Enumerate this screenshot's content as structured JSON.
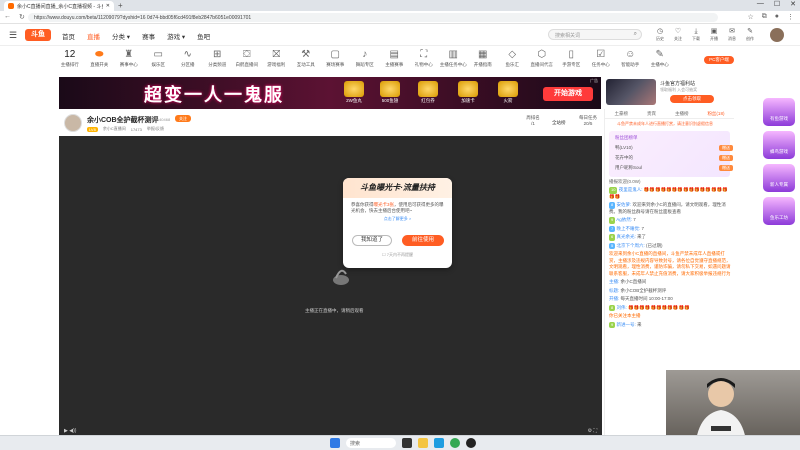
{
  "browser": {
    "tab_title": "余小C直播间直播_余小C直播视频 - 斗鱼",
    "url": "https://www.douyu.com/beta/11209079?dyshid=16 0d74-bbd05f6cd491f8eb2847b6051e00091701",
    "new_tab": "+",
    "win_min": "—",
    "win_max": "☐",
    "win_close": "✕"
  },
  "header": {
    "logo_text": "斗鱼",
    "nav": [
      "首页",
      "直播",
      "分类",
      "赛事",
      "游戏",
      "鱼吧"
    ],
    "search_placeholder": "搜索相关词",
    "icons": [
      "历史",
      "关注",
      "下载",
      "开播",
      "消息",
      "创作"
    ],
    "nav_badge": "9"
  },
  "categories": {
    "count_label": "主播排行",
    "count_value": "12",
    "items": [
      "直播开关",
      "赛事中心",
      "娱乐区",
      "分区播",
      "分类频道",
      "白鹤直播间",
      "游戏福利",
      "互动工具",
      "赛场赛事",
      "舞蹈专区",
      "主播赛事",
      "礼物中心",
      "主播任务中心",
      "开播指南",
      "鱼乐汇",
      "直播间代言",
      "手游专区",
      "任务中心",
      "智能助手",
      "主播中心"
    ]
  },
  "banner": {
    "title": "超变一人一鬼服",
    "prizes": [
      "2W鱼丸",
      "500鱼翅",
      "红包券",
      "加速卡",
      "火箭"
    ],
    "start_label": "开始游戏",
    "ad_label": "广告"
  },
  "promo": {
    "pc_tag": "PC客户端",
    "title": "斗鱼官方福利站",
    "subtitle": "领取福利 入会可抽奖",
    "button": "点击领取"
  },
  "room": {
    "title": "余小COB全护截杯测评",
    "room_id": "11140468",
    "follow": "关注",
    "badge": "LV8",
    "category": "余小C直播间",
    "heat": "17473",
    "report": "举报/反馈",
    "rank_label": "周排名",
    "rank_value": "/1",
    "all_station": "全站榜",
    "task_label": "每日任务",
    "task_value": "20/5"
  },
  "player": {
    "loading_text": "主播正在直播中，请稍后观看",
    "modal_title": "斗鱼曝光卡·流量扶持",
    "modal_body_1": "恭喜你获得",
    "modal_highlight": "曝光卡3张",
    "modal_body_2": "，使用后可获得更多的曝光机会，快去主播后台使用吧~",
    "modal_link": "点击了解更多 >",
    "btn_know": "我知道了",
    "btn_sign": "前往使用",
    "modal_foot": "7天内不再提醒",
    "ctrl_left": "▶  ◀))",
    "ctrl_right": "⚙  ⛶"
  },
  "sidebar": {
    "tabs": [
      "土豪榜",
      "贵宾",
      "主播榜",
      "粉丝(18)"
    ],
    "notice": "斗鱼严禁未成年人进行直播打赏，请注意识别虚假信息",
    "fan_title": "粉丝团榜单",
    "fan_rows": [
      {
        "name": "鸭(LV10)",
        "tag": "赠送"
      },
      {
        "name": "花卉中的",
        "tag": "赠送"
      },
      {
        "name": "用户昵称Soul",
        "tag": "赠送"
      }
    ],
    "chat_header": "播报欢迎(0.0W)",
    "chats": [
      {
        "lv": "10",
        "name": "夜里是鬼人:",
        "text": "🎁🎁🎁🎁🎁🎁🎁🎁🎁🎁🎁🎁🎁🎁🎁🎁🎁"
      },
      {
        "lv": "8",
        "name": "安佐萝:",
        "text": "欢迎来到余小C的直播间，请文明观看，理性消费。我的粉丝群号请在粉丝面板查看"
      },
      {
        "lv": "9",
        "name": "Ag依然:",
        "text": "7"
      },
      {
        "lv": "7",
        "name": "晚上不睡觉:",
        "text": "7"
      },
      {
        "lv": "6",
        "name": "真光余光:",
        "text": "来了"
      },
      {
        "lv": "5",
        "name": "北京下个周六:",
        "text": "(已过期)"
      },
      {
        "lv": "",
        "name": "",
        "text": "欢迎来到余小C直播的直播间，斗鱼严禁未成年人直播或打赏，主播涉及违规内容导致封号，请各位自觉遵守直播规范，文明观看，理性消费，谨防诈骗，请勿私下交易，如遇问题请联系客服，未成年人禁止充值消费，请大家积极举报违规行为"
      },
      {
        "lv": "",
        "name": "主播:",
        "text": "余小C直播间"
      },
      {
        "lv": "",
        "name": "标题:",
        "text": "余小COB全护截杯测评"
      },
      {
        "lv": "",
        "name": "开播:",
        "text": "每天直播时间 10:00-17:00"
      },
      {
        "lv": "8",
        "name": "刘伟:",
        "text": "🎁🎁🎁🎁🎁🎁🎁🎁🎁🎁🎁"
      },
      {
        "lv": "",
        "name": "",
        "text": "你已关注本主播"
      },
      {
        "lv": "9",
        "name": "新进一号:",
        "text": "来"
      }
    ]
  },
  "floatads": [
    "有鱼游戏",
    "蜂鸟游戏",
    "新人专属",
    "鱼乐工坊"
  ],
  "taskbar": {
    "search": "搜索"
  }
}
